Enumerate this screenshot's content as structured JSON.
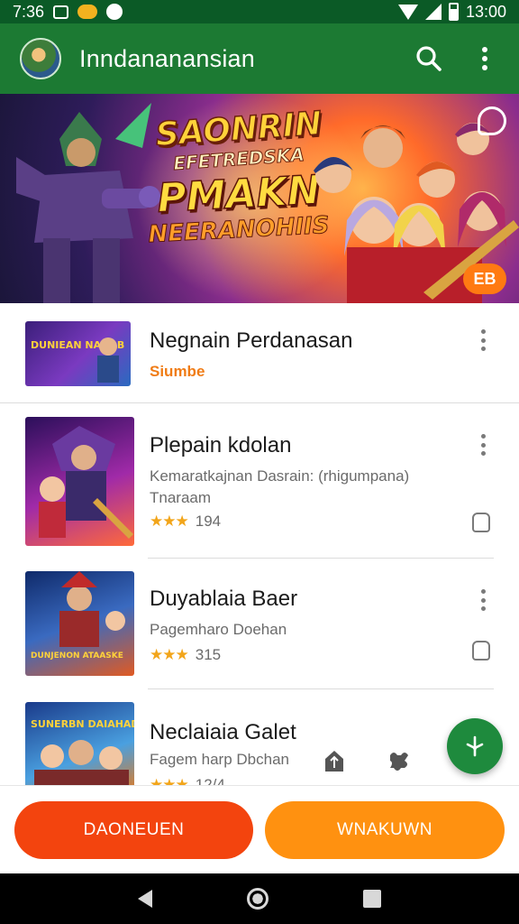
{
  "status_bar": {
    "time": "7:36",
    "clock": "13:00"
  },
  "app_bar": {
    "title": "Inndananansian"
  },
  "banner": {
    "line1": "SAONRIN",
    "line2": "EFETREDSKA",
    "line3": "PMAKN",
    "line4": "NEERANOHIIS",
    "badge": "EB"
  },
  "list": {
    "items": [
      {
        "title": "Negnain Perdanasan",
        "tag": "Siumbe"
      },
      {
        "title": "Plepain kdolan",
        "description": "Kemaratkajnan Dasrain: (rhigumpana)",
        "description2": "Tnaraam",
        "rating": "194"
      },
      {
        "title": "Duyablaia Baer",
        "description": "Pagemharo Doehan",
        "rating": "315"
      },
      {
        "title": "Neclaiaia Galet",
        "description": "Fagem harp Dbchan",
        "rating": "12/4"
      }
    ]
  },
  "thumbnails": {
    "item1": "DUNIEAN NAHAB",
    "item3": "DUNJENON ATAASKE",
    "item4": "SUNERBN DAIAHADIK"
  },
  "buttons": {
    "left_label": "DAONEUEN",
    "right_label": "WNAKUWN"
  },
  "colors": {
    "app_bar": "#1c7a33",
    "status_bar": "#0b5a26",
    "button_left": "#f3440e",
    "button_right": "#ff9110",
    "fab": "#1e8a3d",
    "tag": "#f07c16",
    "star": "#f2a51a"
  },
  "icons": {
    "search": "search-icon",
    "more": "more-vert-icon",
    "bookmark": "bookmark-icon",
    "fab": "tool-icon",
    "upload": "upload-icon",
    "puzzle": "puzzle-icon"
  }
}
